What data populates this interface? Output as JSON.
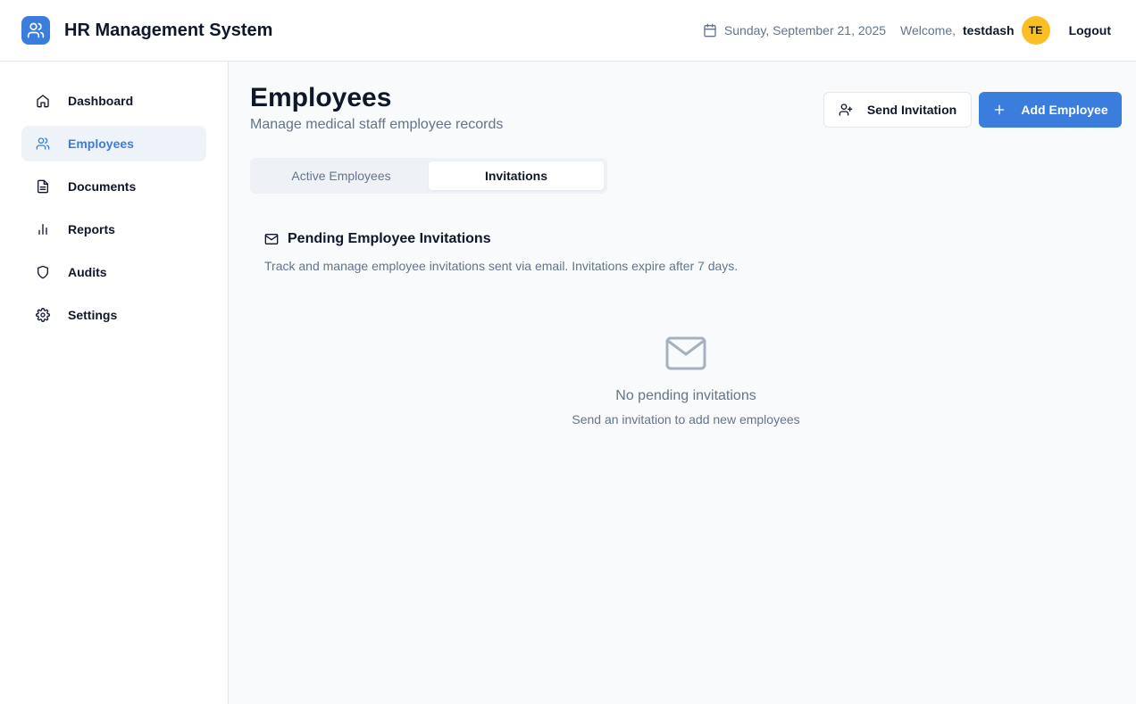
{
  "app": {
    "title": "HR Management System",
    "logo_icon": "users-icon",
    "accent": "#3b7ddd"
  },
  "header": {
    "date": "Sunday, September 21, 2025",
    "welcome": "Welcome,",
    "username": "testdash",
    "avatar_initials": "TE",
    "avatar_color": "#fbbf24",
    "logout_label": "Logout"
  },
  "sidebar": {
    "items": [
      {
        "label": "Dashboard",
        "icon": "home-icon",
        "active": false
      },
      {
        "label": "Employees",
        "icon": "users-icon",
        "active": true
      },
      {
        "label": "Documents",
        "icon": "document-icon",
        "active": false
      },
      {
        "label": "Reports",
        "icon": "bar-chart-icon",
        "active": false
      },
      {
        "label": "Audits",
        "icon": "shield-icon",
        "active": false
      },
      {
        "label": "Settings",
        "icon": "gear-icon",
        "active": false
      }
    ]
  },
  "page": {
    "title": "Employees",
    "subtitle": "Manage medical staff employee records",
    "send_invitation_label": "Send Invitation",
    "add_employee_label": "Add Employee"
  },
  "tabs": [
    {
      "label": "Active Employees",
      "active": false
    },
    {
      "label": "Invitations",
      "active": true
    }
  ],
  "invitations": {
    "title": "Pending Employee Invitations",
    "description": "Track and manage employee invitations sent via email. Invitations expire after 7 days.",
    "empty_title": "No pending invitations",
    "empty_subtitle": "Send an invitation to add new employees"
  }
}
